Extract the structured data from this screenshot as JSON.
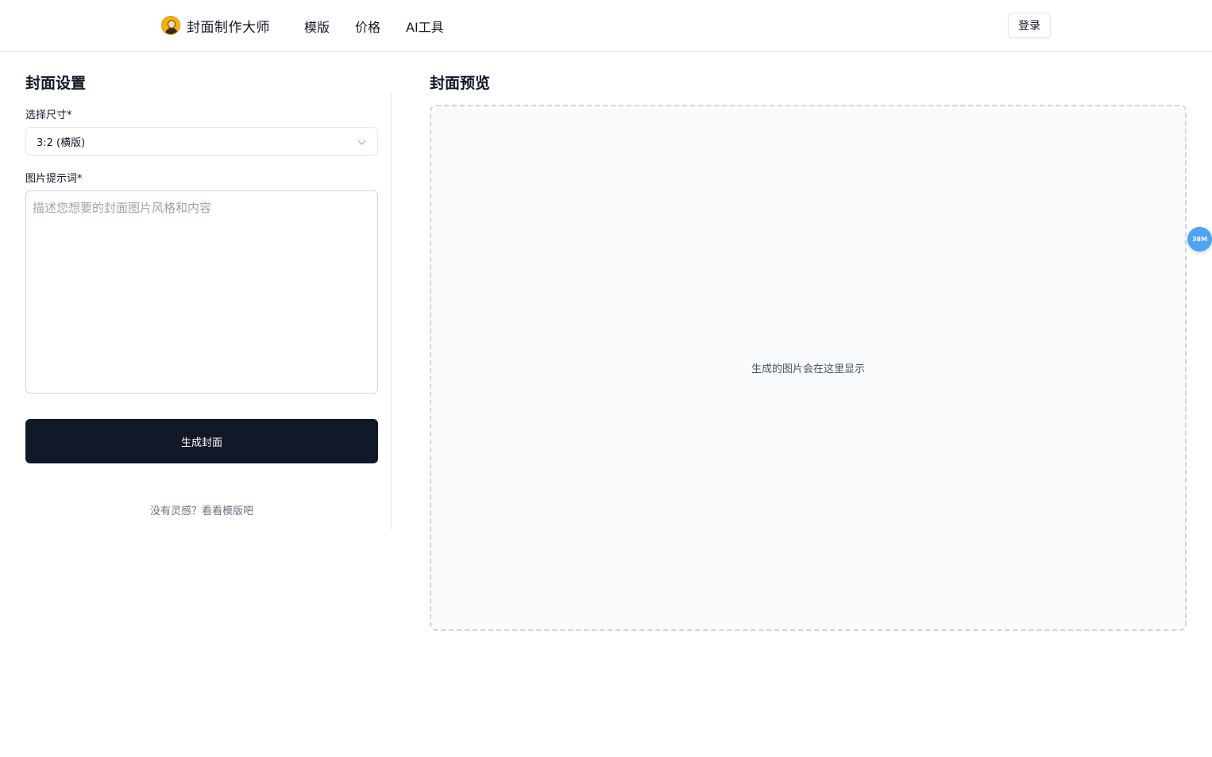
{
  "header": {
    "brand_name": "封面制作大师",
    "nav": [
      "模版",
      "价格",
      "AI工具"
    ],
    "login_label": "登录"
  },
  "settings": {
    "title": "封面设置",
    "size_label": "选择尺寸*",
    "size_value": "3:2 (横版)",
    "prompt_label": "图片提示词*",
    "prompt_placeholder": "描述您想要的封面图片风格和内容",
    "prompt_value": "",
    "generate_label": "生成封面",
    "hint_link": "没有灵感？看看模版吧"
  },
  "preview": {
    "title": "封面预览",
    "placeholder": "生成的图片会在这里显示"
  },
  "float_badge": {
    "label": "38M",
    "color": "#4da3f5"
  },
  "colors": {
    "primary_button": "#111827",
    "border": "#e5e7eb",
    "preview_bg": "#f9fafb"
  }
}
